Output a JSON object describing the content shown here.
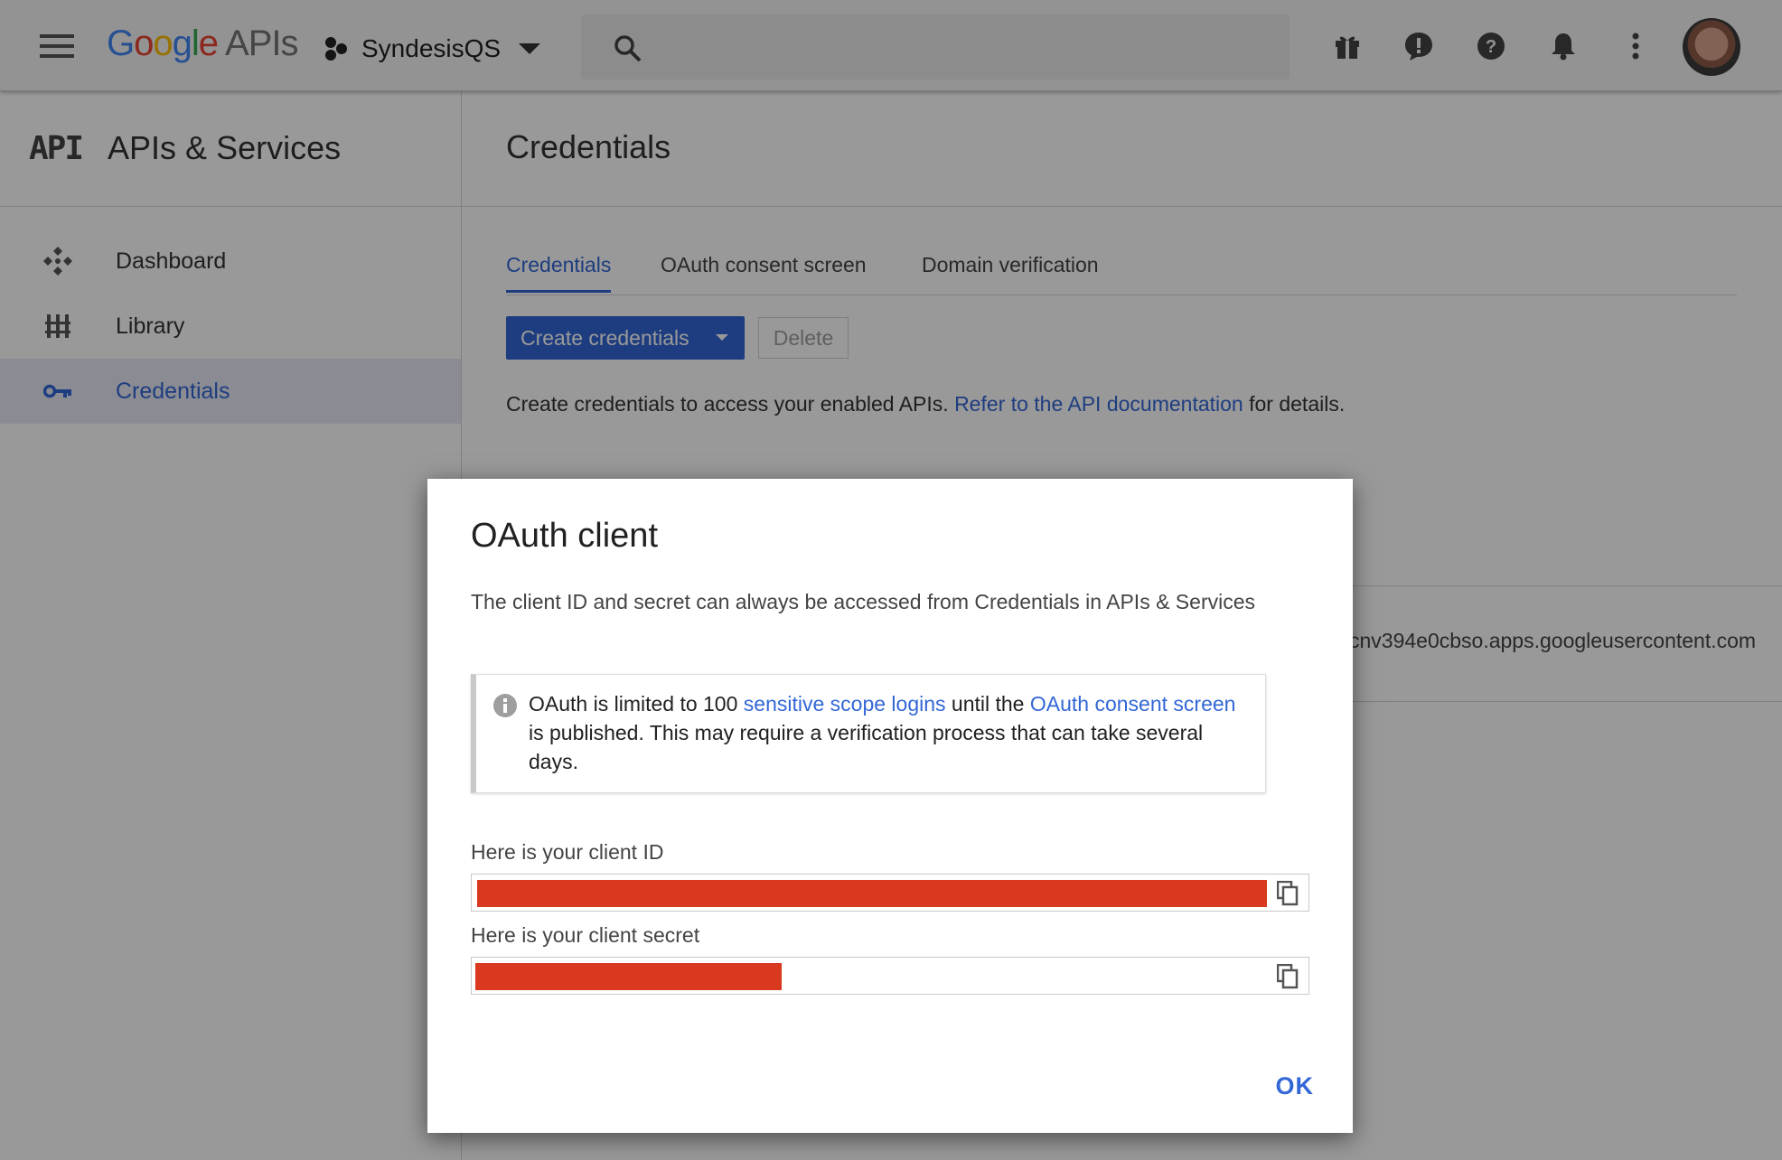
{
  "topbar": {
    "logo_google": [
      "G",
      "o",
      "o",
      "g",
      "l",
      "e"
    ],
    "logo_apis": "APIs",
    "project_name": "SyndesisQS",
    "icons": [
      "menu-icon",
      "gift-icon",
      "feedback-icon",
      "help-icon",
      "notifications-icon",
      "more-vert-icon"
    ]
  },
  "sidebar": {
    "mark": "API",
    "title": "APIs & Services",
    "items": [
      {
        "label": "Dashboard",
        "icon": "dashboard-icon"
      },
      {
        "label": "Library",
        "icon": "library-icon"
      },
      {
        "label": "Credentials",
        "icon": "key-icon",
        "active": true
      }
    ]
  },
  "main": {
    "title": "Credentials",
    "tabs": [
      {
        "label": "Credentials",
        "active": true
      },
      {
        "label": "OAuth consent screen"
      },
      {
        "label": "Domain verification"
      }
    ],
    "create_button": "Create credentials",
    "delete_button": "Delete",
    "info_prefix": "Create credentials to access your enabled APIs.",
    "info_link": "Refer to the API documentation",
    "info_suffix": "for details.",
    "row_client_id_fragment": "cnv394e0cbso.apps.googleusercontent.com"
  },
  "dialog": {
    "title": "OAuth client",
    "description": "The client ID and secret can always be accessed from Credentials in APIs & Services",
    "note": {
      "t1": "OAuth is limited to 100 ",
      "link1": "sensitive scope logins",
      "t2": " until the ",
      "link2": "OAuth consent screen",
      "t3": " is published. This may require a verification process that can take several days."
    },
    "client_id_label": "Here is your client ID",
    "client_secret_label": "Here is your client secret",
    "ok_label": "OK"
  },
  "colors": {
    "accent": "#3367d6",
    "redaction": "#d8391f",
    "overlay": "rgba(0,0,0,0.40)"
  }
}
